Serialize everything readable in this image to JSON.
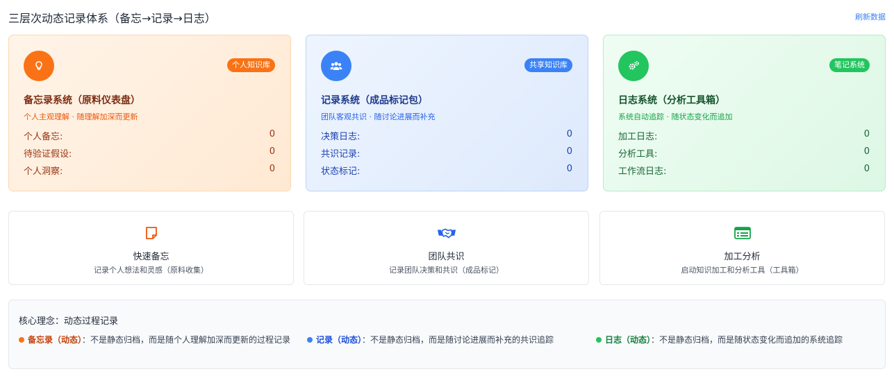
{
  "header": {
    "title": "三层次动态记录体系（备忘→记录→日志）",
    "refresh_label": "刷新数据"
  },
  "systems": [
    {
      "icon": "lightbulb-icon",
      "badge": "个人知识库",
      "title": "备忘录系统（原料仪表盘）",
      "subtitle": "个人主观理解 · 随理解加深而更新",
      "color": "#f97316",
      "stats": [
        {
          "label": "个人备忘:",
          "value": "0"
        },
        {
          "label": "待验证假设:",
          "value": "0"
        },
        {
          "label": "个人洞察:",
          "value": "0"
        }
      ]
    },
    {
      "icon": "users-icon",
      "badge": "共享知识库",
      "title": "记录系统（成品标记包）",
      "subtitle": "团队客观共识 · 随讨论进展而补充",
      "color": "#3b82f6",
      "stats": [
        {
          "label": "决策日志:",
          "value": "0"
        },
        {
          "label": "共识记录:",
          "value": "0"
        },
        {
          "label": "状态标记:",
          "value": "0"
        }
      ]
    },
    {
      "icon": "cogs-icon",
      "badge": "笔记系统",
      "title": "日志系统（分析工具箱）",
      "subtitle": "系统自动追踪 · 随状态变化而追加",
      "color": "#22c55e",
      "stats": [
        {
          "label": "加工日志:",
          "value": "0"
        },
        {
          "label": "分析工具:",
          "value": "0"
        },
        {
          "label": "工作流日志:",
          "value": "0"
        }
      ]
    }
  ],
  "actions": [
    {
      "icon": "sticky-note-icon",
      "title": "快速备忘",
      "desc": "记录个人想法和灵感（原料收集）",
      "color": "#ea580c"
    },
    {
      "icon": "handshake-icon",
      "title": "团队共识",
      "desc": "记录团队决策和共识（成品标记）",
      "color": "#2563eb"
    },
    {
      "icon": "table-list-icon",
      "title": "加工分析",
      "desc": "启动知识加工和分析工具（工具箱）",
      "color": "#16a34a"
    }
  ],
  "concept": {
    "title": "核心理念：动态过程记录",
    "items": [
      {
        "keyword": "备忘录（动态）",
        "text": "：不是静态归档，而是随个人理解加深而更新的过程记录"
      },
      {
        "keyword": "记录（动态）",
        "text": "：不是静态归档，而是随讨论进展而补充的共识追踪"
      },
      {
        "keyword": "日志（动态）",
        "text": "：不是静态归档，而是随状态变化而追加的系统追踪"
      }
    ]
  }
}
